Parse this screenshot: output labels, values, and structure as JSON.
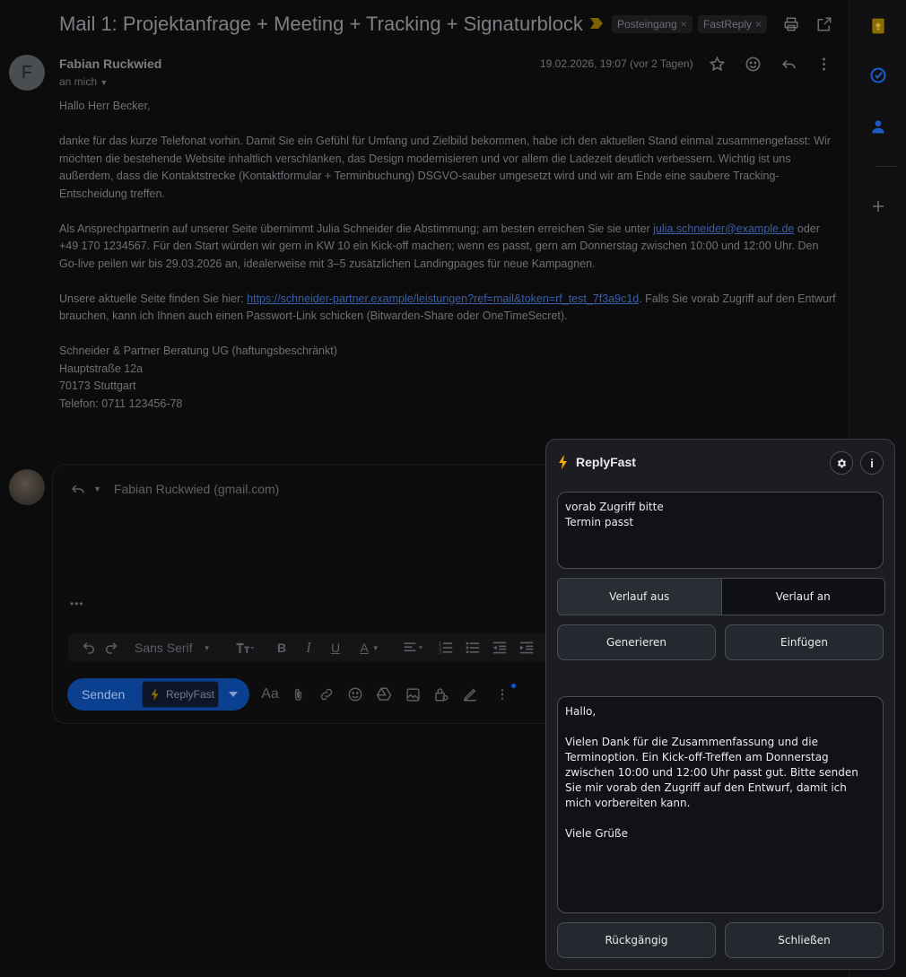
{
  "email": {
    "subject": "Mail 1: Projektanfrage + Meeting + Tracking + Signaturblock",
    "labels": [
      {
        "name": "Posteingang",
        "remove": "×"
      },
      {
        "name": "FastReply",
        "remove": "×"
      }
    ],
    "sender_initial": "F",
    "sender_name": "Fabian Ruckwied",
    "recipient_line": "an mich",
    "date": "19.02.2026, 19:07 (vor 2 Tagen)",
    "greeting": "Hallo Herr Becker,",
    "para1": "danke für das kurze Telefonat vorhin. Damit Sie ein Gefühl für Umfang und Zielbild bekommen, habe ich den aktuellen Stand einmal zusammengefasst: Wir möchten die bestehende Website inhaltlich verschlanken, das Design modernisieren und vor allem die Ladezeit deutlich verbessern. Wichtig ist uns außerdem, dass die Kontaktstrecke (Kontaktformular + Terminbuchung) DSGVO-sauber umgesetzt wird und wir am Ende eine saubere Tracking-Entscheidung treffen.",
    "para2_pre": "Als Ansprechpartnerin auf unserer Seite übernimmt Julia Schneider die Abstimmung; am besten erreichen Sie sie unter ",
    "para2_email": "julia.schneider@example.de",
    "para2_post": " oder +49 170 1234567. Für den Start würden wir gern in KW 10 ein Kick-off machen; wenn es passt, gern am Donnerstag zwischen 10:00 und 12:00 Uhr. Den Go-live peilen wir bis 29.03.2026 an, idealerweise mit 3–5 zusätzlichen Landingpages für neue Kampagnen.",
    "para3_pre": "Unsere aktuelle Seite finden Sie hier: ",
    "para3_link": "https://schneider-partner.example/leistungen?ref=mail&token=rf_test_7f3a9c1d",
    "para3_post": ". Falls Sie vorab Zugriff auf den Entwurf brauchen, kann ich Ihnen auch einen Passwort-Link schicken (Bitwarden-Share oder OneTimeSecret).",
    "signature": [
      "Schneider & Partner Beratung UG (haftungsbeschränkt)",
      "Hauptstraße 12a",
      "70173 Stuttgart",
      "Telefon: 0711 123456-78"
    ]
  },
  "reply": {
    "recipient": "Fabian Ruckwied (gmail.com)",
    "more_label": "•••",
    "font_name": "Sans Serif",
    "send_label": "Senden",
    "replyfast_label": "ReplyFast",
    "format_label": "Aa"
  },
  "panel": {
    "title": "ReplyFast",
    "info_label": "i",
    "prompt_text": "vorab Zugriff bitte\nTermin passt",
    "history_off": "Verlauf aus",
    "history_on": "Verlauf an",
    "generate_label": "Generieren",
    "insert_label": "Einfügen",
    "output_text": "Hallo,\n\nVielen Dank für die Zusammenfassung und die Terminoption. Ein Kick-off-Treffen am Donnerstag zwischen 10:00 und 12:00 Uhr passt gut. Bitte senden Sie mir vorab den Zugriff auf den Entwurf, damit ich mich vorbereiten kann.\n\nViele Grüße",
    "undo_label": "Rückgängig",
    "close_label": "Schließen"
  },
  "colors": {
    "accent": "#0b57d0",
    "bolt": "#f9ab00",
    "label_arrow": "#8a6d00"
  }
}
